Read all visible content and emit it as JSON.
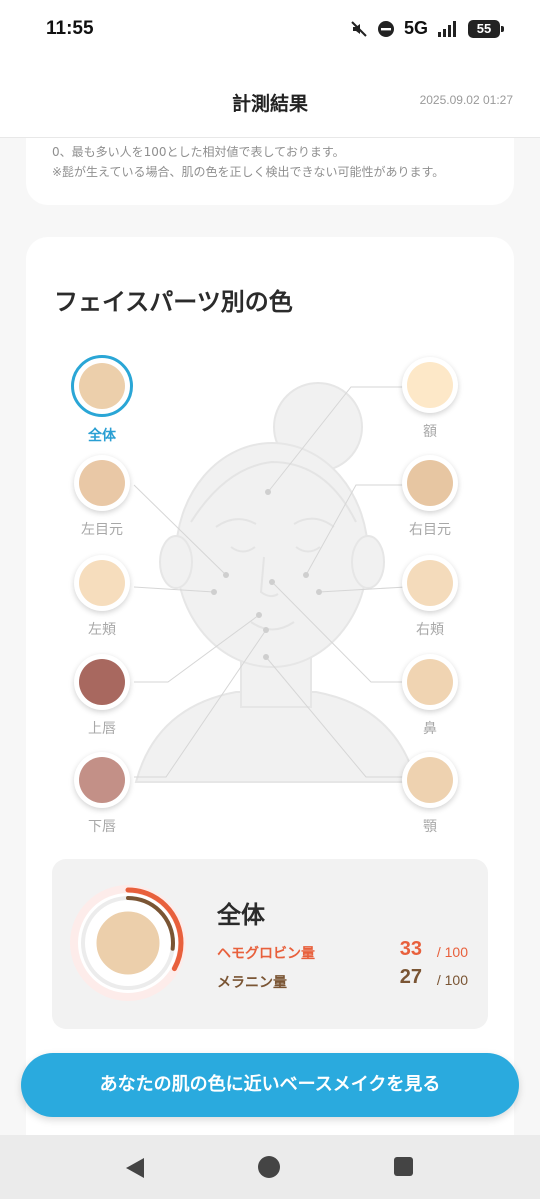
{
  "status": {
    "time": "11:55",
    "network": "5G",
    "battery": "55"
  },
  "header": {
    "title": "計測結果",
    "date": "2025.09.02 01:27"
  },
  "notes": [
    "0、最も多い人を100とした相対値で表しております。",
    "※髭が生えている場合、肌の色を正しく検出できない可能性があります。"
  ],
  "face_parts": {
    "title": "フェイスパーツ別の色",
    "items": [
      {
        "label": "全体",
        "color": "#eccfab",
        "selected": true
      },
      {
        "label": "額",
        "color": "#fde8c8",
        "selected": false
      },
      {
        "label": "左目元",
        "color": "#e9c8a6",
        "selected": false
      },
      {
        "label": "右目元",
        "color": "#e7c6a2",
        "selected": false
      },
      {
        "label": "左頬",
        "color": "#f6ddbd",
        "selected": false
      },
      {
        "label": "右頬",
        "color": "#f4dbbb",
        "selected": false
      },
      {
        "label": "上唇",
        "color": "#a8685f",
        "selected": false
      },
      {
        "label": "鼻",
        "color": "#f0d4b2",
        "selected": false
      },
      {
        "label": "下唇",
        "color": "#c39087",
        "selected": false
      },
      {
        "label": "顎",
        "color": "#eed2b0",
        "selected": false
      }
    ]
  },
  "summary": {
    "title": "全体",
    "swatch_color": "#eccfab",
    "hemoglobin": {
      "label": "ヘモグロビン量",
      "value": "33",
      "max": "/ 100",
      "value_num": 33,
      "color": "#e8603c"
    },
    "melanin": {
      "label": "メラニン量",
      "value": "27",
      "max": "/ 100",
      "value_num": 27,
      "color": "#7a5534"
    }
  },
  "cta": {
    "label": "あなたの肌の色に近いベースメイクを見る"
  }
}
